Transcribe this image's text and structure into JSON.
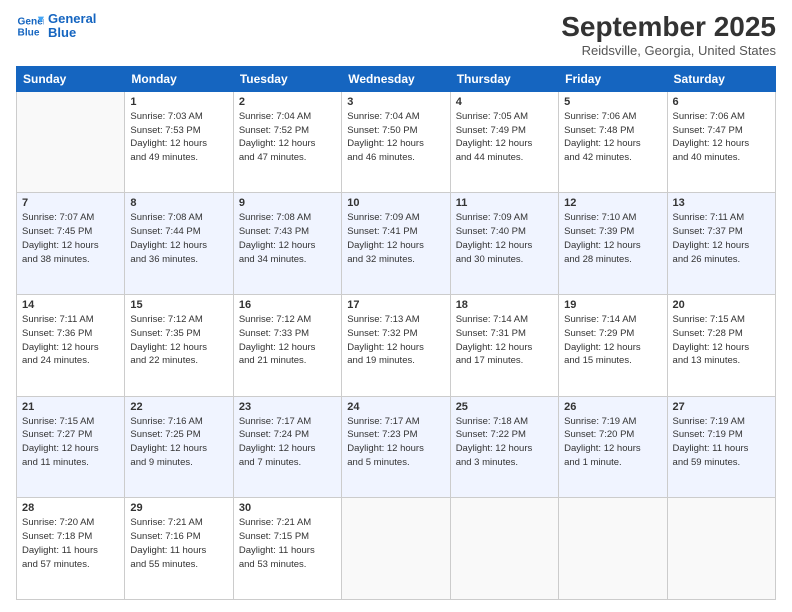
{
  "logo": {
    "line1": "General",
    "line2": "Blue"
  },
  "title": "September 2025",
  "subtitle": "Reidsville, Georgia, United States",
  "days_header": [
    "Sunday",
    "Monday",
    "Tuesday",
    "Wednesday",
    "Thursday",
    "Friday",
    "Saturday"
  ],
  "weeks": [
    [
      {
        "day": "",
        "info": ""
      },
      {
        "day": "1",
        "info": "Sunrise: 7:03 AM\nSunset: 7:53 PM\nDaylight: 12 hours\nand 49 minutes."
      },
      {
        "day": "2",
        "info": "Sunrise: 7:04 AM\nSunset: 7:52 PM\nDaylight: 12 hours\nand 47 minutes."
      },
      {
        "day": "3",
        "info": "Sunrise: 7:04 AM\nSunset: 7:50 PM\nDaylight: 12 hours\nand 46 minutes."
      },
      {
        "day": "4",
        "info": "Sunrise: 7:05 AM\nSunset: 7:49 PM\nDaylight: 12 hours\nand 44 minutes."
      },
      {
        "day": "5",
        "info": "Sunrise: 7:06 AM\nSunset: 7:48 PM\nDaylight: 12 hours\nand 42 minutes."
      },
      {
        "day": "6",
        "info": "Sunrise: 7:06 AM\nSunset: 7:47 PM\nDaylight: 12 hours\nand 40 minutes."
      }
    ],
    [
      {
        "day": "7",
        "info": "Sunrise: 7:07 AM\nSunset: 7:45 PM\nDaylight: 12 hours\nand 38 minutes."
      },
      {
        "day": "8",
        "info": "Sunrise: 7:08 AM\nSunset: 7:44 PM\nDaylight: 12 hours\nand 36 minutes."
      },
      {
        "day": "9",
        "info": "Sunrise: 7:08 AM\nSunset: 7:43 PM\nDaylight: 12 hours\nand 34 minutes."
      },
      {
        "day": "10",
        "info": "Sunrise: 7:09 AM\nSunset: 7:41 PM\nDaylight: 12 hours\nand 32 minutes."
      },
      {
        "day": "11",
        "info": "Sunrise: 7:09 AM\nSunset: 7:40 PM\nDaylight: 12 hours\nand 30 minutes."
      },
      {
        "day": "12",
        "info": "Sunrise: 7:10 AM\nSunset: 7:39 PM\nDaylight: 12 hours\nand 28 minutes."
      },
      {
        "day": "13",
        "info": "Sunrise: 7:11 AM\nSunset: 7:37 PM\nDaylight: 12 hours\nand 26 minutes."
      }
    ],
    [
      {
        "day": "14",
        "info": "Sunrise: 7:11 AM\nSunset: 7:36 PM\nDaylight: 12 hours\nand 24 minutes."
      },
      {
        "day": "15",
        "info": "Sunrise: 7:12 AM\nSunset: 7:35 PM\nDaylight: 12 hours\nand 22 minutes."
      },
      {
        "day": "16",
        "info": "Sunrise: 7:12 AM\nSunset: 7:33 PM\nDaylight: 12 hours\nand 21 minutes."
      },
      {
        "day": "17",
        "info": "Sunrise: 7:13 AM\nSunset: 7:32 PM\nDaylight: 12 hours\nand 19 minutes."
      },
      {
        "day": "18",
        "info": "Sunrise: 7:14 AM\nSunset: 7:31 PM\nDaylight: 12 hours\nand 17 minutes."
      },
      {
        "day": "19",
        "info": "Sunrise: 7:14 AM\nSunset: 7:29 PM\nDaylight: 12 hours\nand 15 minutes."
      },
      {
        "day": "20",
        "info": "Sunrise: 7:15 AM\nSunset: 7:28 PM\nDaylight: 12 hours\nand 13 minutes."
      }
    ],
    [
      {
        "day": "21",
        "info": "Sunrise: 7:15 AM\nSunset: 7:27 PM\nDaylight: 12 hours\nand 11 minutes."
      },
      {
        "day": "22",
        "info": "Sunrise: 7:16 AM\nSunset: 7:25 PM\nDaylight: 12 hours\nand 9 minutes."
      },
      {
        "day": "23",
        "info": "Sunrise: 7:17 AM\nSunset: 7:24 PM\nDaylight: 12 hours\nand 7 minutes."
      },
      {
        "day": "24",
        "info": "Sunrise: 7:17 AM\nSunset: 7:23 PM\nDaylight: 12 hours\nand 5 minutes."
      },
      {
        "day": "25",
        "info": "Sunrise: 7:18 AM\nSunset: 7:22 PM\nDaylight: 12 hours\nand 3 minutes."
      },
      {
        "day": "26",
        "info": "Sunrise: 7:19 AM\nSunset: 7:20 PM\nDaylight: 12 hours\nand 1 minute."
      },
      {
        "day": "27",
        "info": "Sunrise: 7:19 AM\nSunset: 7:19 PM\nDaylight: 11 hours\nand 59 minutes."
      }
    ],
    [
      {
        "day": "28",
        "info": "Sunrise: 7:20 AM\nSunset: 7:18 PM\nDaylight: 11 hours\nand 57 minutes."
      },
      {
        "day": "29",
        "info": "Sunrise: 7:21 AM\nSunset: 7:16 PM\nDaylight: 11 hours\nand 55 minutes."
      },
      {
        "day": "30",
        "info": "Sunrise: 7:21 AM\nSunset: 7:15 PM\nDaylight: 11 hours\nand 53 minutes."
      },
      {
        "day": "",
        "info": ""
      },
      {
        "day": "",
        "info": ""
      },
      {
        "day": "",
        "info": ""
      },
      {
        "day": "",
        "info": ""
      }
    ]
  ]
}
